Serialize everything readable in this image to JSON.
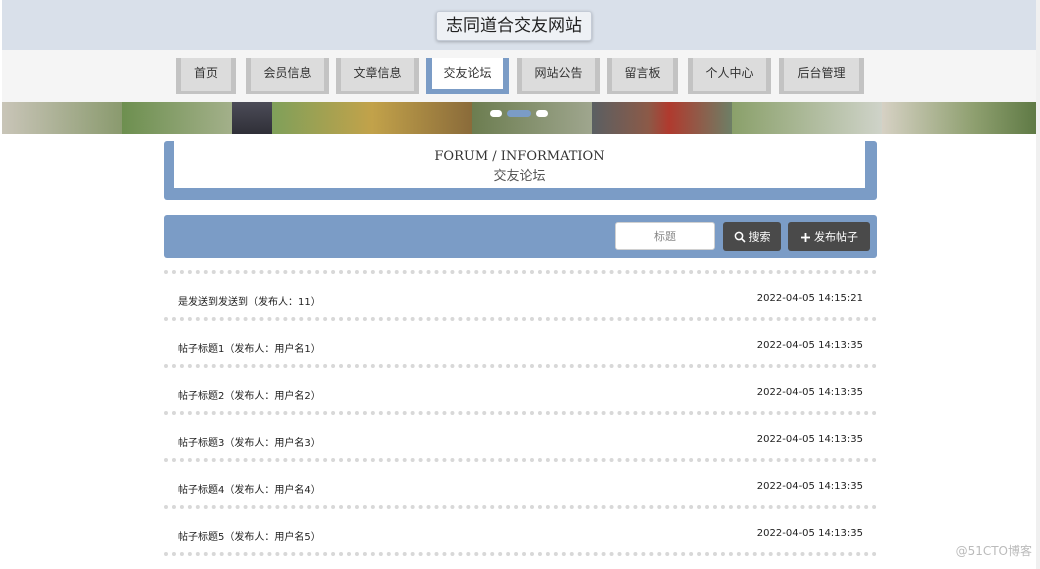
{
  "header": {
    "site_title": "志同道合交友网站"
  },
  "nav": {
    "items": [
      {
        "label": "首页"
      },
      {
        "label": "会员信息"
      },
      {
        "label": "文章信息"
      },
      {
        "label": "交友论坛",
        "active": true
      },
      {
        "label": "网站公告"
      },
      {
        "label": "留言板"
      },
      {
        "label": "个人中心"
      },
      {
        "label": "后台管理"
      }
    ]
  },
  "section": {
    "title_en": "FORUM / INFORMATION",
    "title_cn": "交友论坛"
  },
  "search": {
    "placeholder": "标题",
    "search_label": "搜索",
    "publish_label": "发布帖子"
  },
  "posts": [
    {
      "title": "是发送到发送到（发布人：11）",
      "time": "2022-04-05 14:15:21"
    },
    {
      "title": "帖子标题1（发布人：用户名1）",
      "time": "2022-04-05 14:13:35"
    },
    {
      "title": "帖子标题2（发布人：用户名2）",
      "time": "2022-04-05 14:13:35"
    },
    {
      "title": "帖子标题3（发布人：用户名3）",
      "time": "2022-04-05 14:13:35"
    },
    {
      "title": "帖子标题4（发布人：用户名4）",
      "time": "2022-04-05 14:13:35"
    },
    {
      "title": "帖子标题5（发布人：用户名5）",
      "time": "2022-04-05 14:13:35"
    }
  ],
  "watermark": "@51CTO博客",
  "colors": {
    "accent": "#7b9cc6",
    "header_bg": "#d9e0ea",
    "button_dark": "#4a4a4a"
  },
  "icons": {
    "search": "search-icon",
    "publish": "plus-icon"
  }
}
